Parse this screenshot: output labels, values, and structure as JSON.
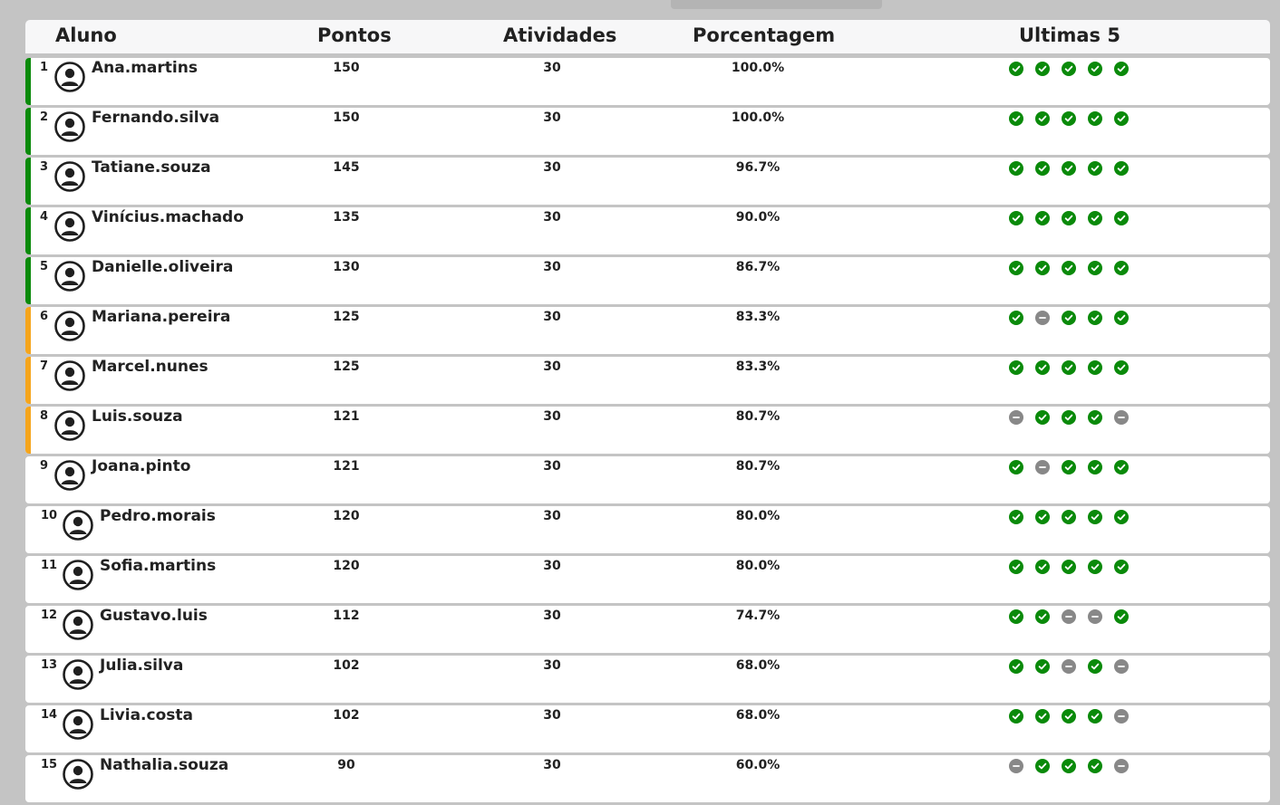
{
  "header": {
    "aluno": "Aluno",
    "pontos": "Pontos",
    "atividades": "Atividades",
    "porcentagem": "Porcentagem",
    "ultimas": "Ultimas 5"
  },
  "colors": {
    "green": "#0a8a0a",
    "orange": "#f5a51c",
    "gray": "#888888",
    "check_green": "#0a8a0a"
  },
  "students": [
    {
      "rank": "1",
      "name": "Ana.martins",
      "pontos": "150",
      "atividades": "30",
      "pct": "100.0%",
      "tier": "green",
      "last5": [
        "ok",
        "ok",
        "ok",
        "ok",
        "ok"
      ]
    },
    {
      "rank": "2",
      "name": "Fernando.silva",
      "pontos": "150",
      "atividades": "30",
      "pct": "100.0%",
      "tier": "green",
      "last5": [
        "ok",
        "ok",
        "ok",
        "ok",
        "ok"
      ]
    },
    {
      "rank": "3",
      "name": "Tatiane.souza",
      "pontos": "145",
      "atividades": "30",
      "pct": "96.7%",
      "tier": "green",
      "last5": [
        "ok",
        "ok",
        "ok",
        "ok",
        "ok"
      ]
    },
    {
      "rank": "4",
      "name": "Vinícius.machado",
      "pontos": "135",
      "atividades": "30",
      "pct": "90.0%",
      "tier": "green",
      "last5": [
        "ok",
        "ok",
        "ok",
        "ok",
        "ok"
      ]
    },
    {
      "rank": "5",
      "name": "Danielle.oliveira",
      "pontos": "130",
      "atividades": "30",
      "pct": "86.7%",
      "tier": "green",
      "last5": [
        "ok",
        "ok",
        "ok",
        "ok",
        "ok"
      ]
    },
    {
      "rank": "6",
      "name": "Mariana.pereira",
      "pontos": "125",
      "atividades": "30",
      "pct": "83.3%",
      "tier": "orange",
      "last5": [
        "ok",
        "miss",
        "ok",
        "ok",
        "ok"
      ]
    },
    {
      "rank": "7",
      "name": "Marcel.nunes",
      "pontos": "125",
      "atividades": "30",
      "pct": "83.3%",
      "tier": "orange",
      "last5": [
        "ok",
        "ok",
        "ok",
        "ok",
        "ok"
      ]
    },
    {
      "rank": "8",
      "name": "Luis.souza",
      "pontos": "121",
      "atividades": "30",
      "pct": "80.7%",
      "tier": "orange",
      "last5": [
        "miss",
        "ok",
        "ok",
        "ok",
        "miss"
      ]
    },
    {
      "rank": "9",
      "name": "Joana.pinto",
      "pontos": "121",
      "atividades": "30",
      "pct": "80.7%",
      "tier": "none",
      "last5": [
        "ok",
        "miss",
        "ok",
        "ok",
        "ok"
      ]
    },
    {
      "rank": "10",
      "name": "Pedro.morais",
      "pontos": "120",
      "atividades": "30",
      "pct": "80.0%",
      "tier": "none",
      "last5": [
        "ok",
        "ok",
        "ok",
        "ok",
        "ok"
      ]
    },
    {
      "rank": "11",
      "name": "Sofia.martins",
      "pontos": "120",
      "atividades": "30",
      "pct": "80.0%",
      "tier": "none",
      "last5": [
        "ok",
        "ok",
        "ok",
        "ok",
        "ok"
      ]
    },
    {
      "rank": "12",
      "name": "Gustavo.luis",
      "pontos": "112",
      "atividades": "30",
      "pct": "74.7%",
      "tier": "none",
      "last5": [
        "ok",
        "ok",
        "miss",
        "miss",
        "ok"
      ]
    },
    {
      "rank": "13",
      "name": "Julia.silva",
      "pontos": "102",
      "atividades": "30",
      "pct": "68.0%",
      "tier": "none",
      "last5": [
        "ok",
        "ok",
        "miss",
        "ok",
        "miss"
      ]
    },
    {
      "rank": "14",
      "name": "Livia.costa",
      "pontos": "102",
      "atividades": "30",
      "pct": "68.0%",
      "tier": "none",
      "last5": [
        "ok",
        "ok",
        "ok",
        "ok",
        "miss"
      ]
    },
    {
      "rank": "15",
      "name": "Nathalia.souza",
      "pontos": "90",
      "atividades": "30",
      "pct": "60.0%",
      "tier": "none",
      "last5": [
        "miss",
        "ok",
        "ok",
        "ok",
        "miss"
      ]
    }
  ]
}
